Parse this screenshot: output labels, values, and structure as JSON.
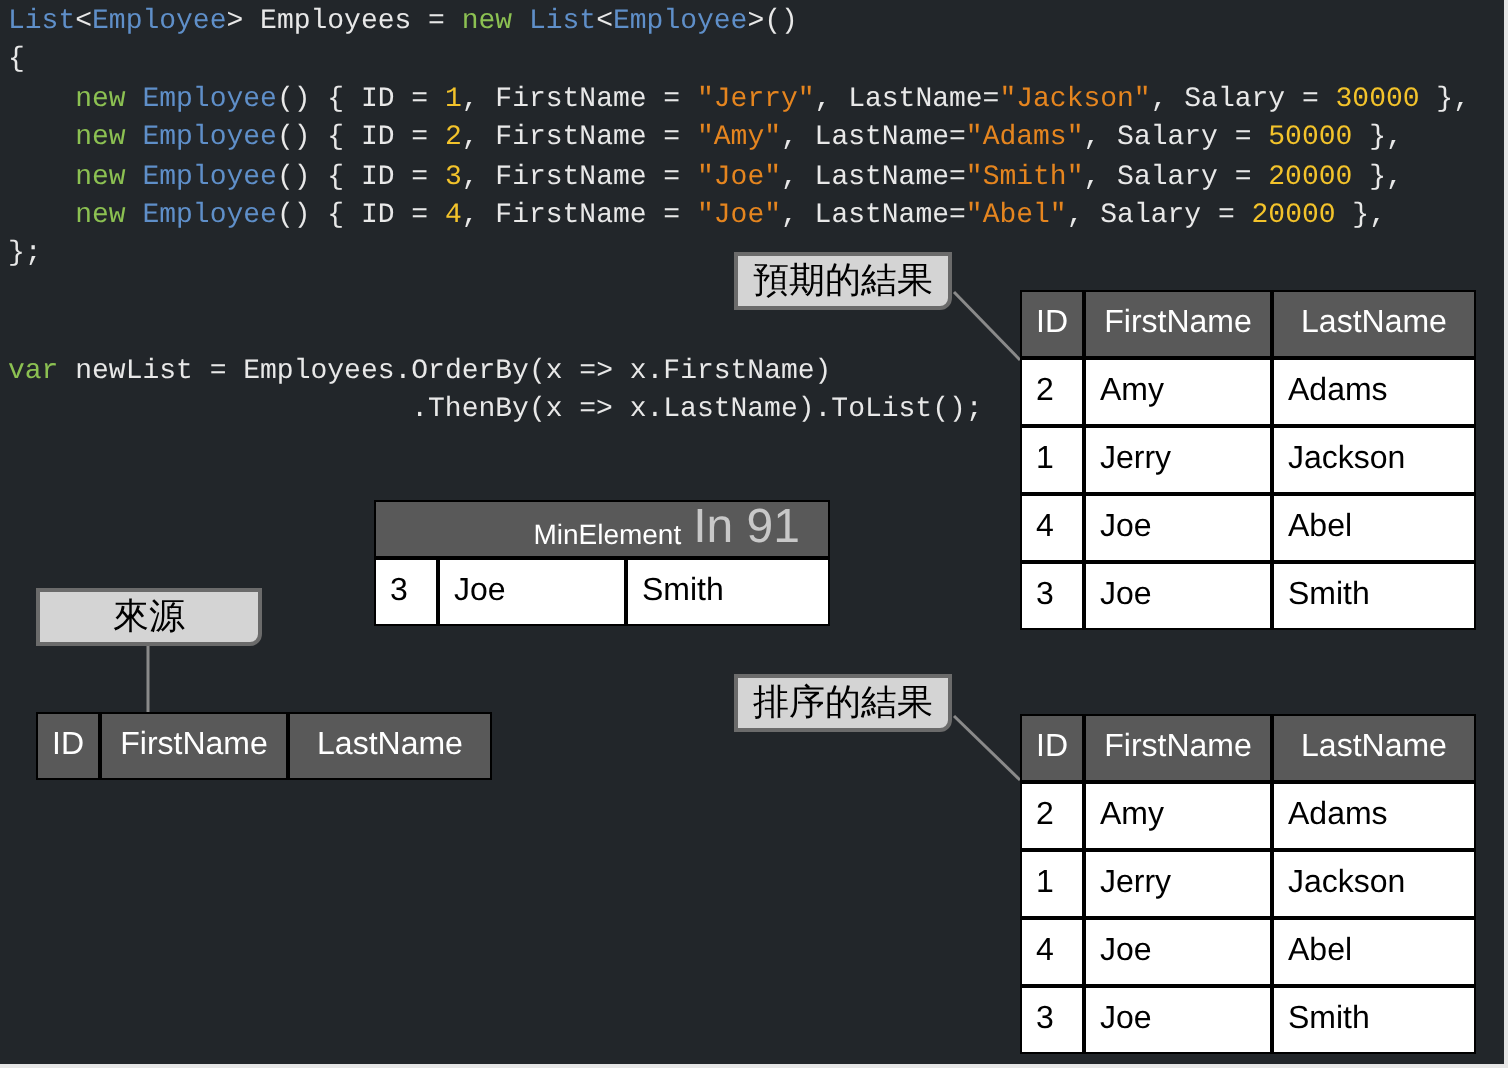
{
  "code_lines": [
    [
      {
        "kind": "type",
        "text": "List"
      },
      {
        "kind": "plain",
        "text": "<"
      },
      {
        "kind": "type",
        "text": "Employee"
      },
      {
        "kind": "plain",
        "text": "> Employees = "
      },
      {
        "kind": "keyword",
        "text": "new"
      },
      {
        "kind": "type",
        "text": " List"
      },
      {
        "kind": "plain",
        "text": "<"
      },
      {
        "kind": "type",
        "text": "Employee"
      },
      {
        "kind": "plain",
        "text": ">()"
      }
    ],
    [
      {
        "kind": "plain",
        "text": "{"
      }
    ],
    [
      {
        "kind": "keyword",
        "text": "    new"
      },
      {
        "kind": "type",
        "text": " Employee"
      },
      {
        "kind": "plain",
        "text": "() { ID = "
      },
      {
        "kind": "number",
        "text": "1"
      },
      {
        "kind": "plain",
        "text": ", FirstName = "
      },
      {
        "kind": "string",
        "text": "\"Jerry\""
      },
      {
        "kind": "plain",
        "text": ", LastName="
      },
      {
        "kind": "string",
        "text": "\"Jackson\""
      },
      {
        "kind": "plain",
        "text": ", Salary = "
      },
      {
        "kind": "number",
        "text": "30000"
      },
      {
        "kind": "plain",
        "text": " },"
      }
    ],
    [
      {
        "kind": "keyword",
        "text": "    new"
      },
      {
        "kind": "type",
        "text": " Employee"
      },
      {
        "kind": "plain",
        "text": "() { ID = "
      },
      {
        "kind": "number",
        "text": "2"
      },
      {
        "kind": "plain",
        "text": ", FirstName = "
      },
      {
        "kind": "string",
        "text": "\"Amy\""
      },
      {
        "kind": "plain",
        "text": ", LastName="
      },
      {
        "kind": "string",
        "text": "\"Adams\""
      },
      {
        "kind": "plain",
        "text": ", Salary = "
      },
      {
        "kind": "number",
        "text": "50000"
      },
      {
        "kind": "plain",
        "text": " },"
      }
    ],
    [
      {
        "kind": "keyword",
        "text": "    new"
      },
      {
        "kind": "type",
        "text": " Employee"
      },
      {
        "kind": "plain",
        "text": "() { ID = "
      },
      {
        "kind": "number",
        "text": "3"
      },
      {
        "kind": "plain",
        "text": ", FirstName = "
      },
      {
        "kind": "string",
        "text": "\"Joe\""
      },
      {
        "kind": "plain",
        "text": ", LastName="
      },
      {
        "kind": "string",
        "text": "\"Smith\""
      },
      {
        "kind": "plain",
        "text": ", Salary = "
      },
      {
        "kind": "number",
        "text": "20000"
      },
      {
        "kind": "plain",
        "text": " },"
      }
    ],
    [
      {
        "kind": "keyword",
        "text": "    new"
      },
      {
        "kind": "type",
        "text": " Employee"
      },
      {
        "kind": "plain",
        "text": "() { ID = "
      },
      {
        "kind": "number",
        "text": "4"
      },
      {
        "kind": "plain",
        "text": ", FirstName = "
      },
      {
        "kind": "string",
        "text": "\"Joe\""
      },
      {
        "kind": "plain",
        "text": ", LastName="
      },
      {
        "kind": "string",
        "text": "\"Abel\""
      },
      {
        "kind": "plain",
        "text": ", Salary = "
      },
      {
        "kind": "number",
        "text": "20000"
      },
      {
        "kind": "plain",
        "text": " },"
      }
    ],
    [
      {
        "kind": "plain",
        "text": "};"
      }
    ]
  ],
  "query_lines": [
    [
      {
        "kind": "keyword",
        "text": "var"
      },
      {
        "kind": "plain",
        "text": " newList = Employees.OrderBy(x => x.FirstName)"
      }
    ],
    [
      {
        "kind": "plain",
        "text": "                        .ThenBy(x => x.LastName).ToList();"
      }
    ]
  ],
  "callouts": [
    {
      "label": "預期的結果"
    },
    {
      "label": "來源"
    },
    {
      "label": "排序的結果"
    }
  ],
  "expected_table": {
    "columns": [
      "ID",
      "FirstName",
      "LastName"
    ],
    "rows": [
      [
        "2",
        "Amy",
        "Adams"
      ],
      [
        "1",
        "Jerry",
        "Jackson"
      ],
      [
        "4",
        "Joe",
        "Abel"
      ],
      [
        "3",
        "Joe",
        "Smith"
      ]
    ]
  },
  "min_element_table": {
    "title": "MinElement",
    "step": "In 91",
    "rows": [
      [
        "3",
        "Joe",
        "Smith"
      ]
    ]
  },
  "source_table": {
    "columns": [
      "ID",
      "FirstName",
      "LastName"
    ]
  },
  "sorted_table": {
    "columns": [
      "ID",
      "FirstName",
      "LastName"
    ],
    "rows": [
      [
        "2",
        "Amy",
        "Adams"
      ],
      [
        "1",
        "Jerry",
        "Jackson"
      ],
      [
        "4",
        "Joe",
        "Abel"
      ],
      [
        "3",
        "Joe",
        "Smith"
      ]
    ]
  }
}
